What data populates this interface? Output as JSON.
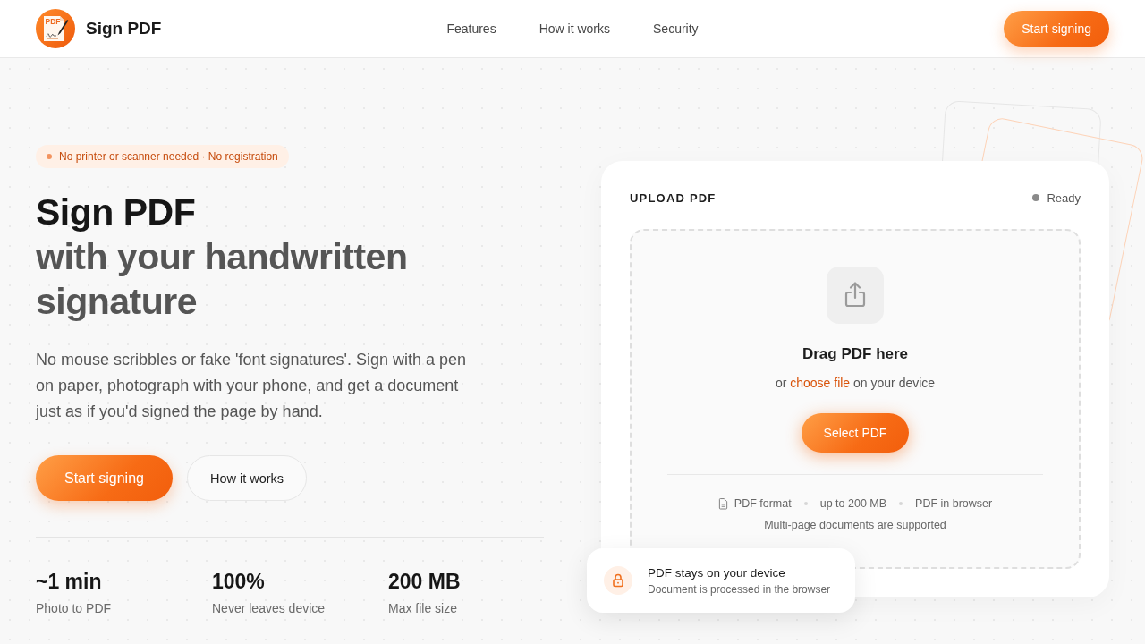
{
  "header": {
    "logo_mark": "PDF",
    "brand": "Sign PDF",
    "nav": [
      {
        "label": "Features"
      },
      {
        "label": "How it works"
      },
      {
        "label": "Security"
      }
    ],
    "cta": "Start signing"
  },
  "hero": {
    "badge": "No printer or scanner needed · No registration",
    "title": "Sign PDF",
    "subtitle": "with your handwritten signature",
    "description": "No mouse scribbles or fake 'font signatures'. Sign with a pen on paper, photograph with your phone, and get a document just as if you'd signed the page by hand.",
    "buttons": [
      {
        "label": "Start signing",
        "kind": "primary"
      },
      {
        "label": "How it works",
        "kind": "secondary"
      }
    ],
    "stats": [
      {
        "value": "~1 min",
        "label": "Photo to PDF"
      },
      {
        "value": "100%",
        "label": "Never leaves device"
      },
      {
        "value": "200 MB",
        "label": "Max file size"
      }
    ]
  },
  "upload_card": {
    "title": "UPLOAD PDF",
    "status": "Ready",
    "drop_title": "Drag PDF here",
    "hint_before": "or",
    "hint_link": "choose file",
    "hint_after": "on your device",
    "button": "Select PDF",
    "features": [
      {
        "kind": "file",
        "label": "PDF format"
      },
      {
        "kind": "plain",
        "label": "up to 200 MB"
      },
      {
        "kind": "plain",
        "label": "PDF in browser"
      }
    ],
    "note": "Multi-page documents are supported"
  },
  "toast": {
    "title": "PDF stays on your device",
    "text": "Document is processed in the browser"
  }
}
